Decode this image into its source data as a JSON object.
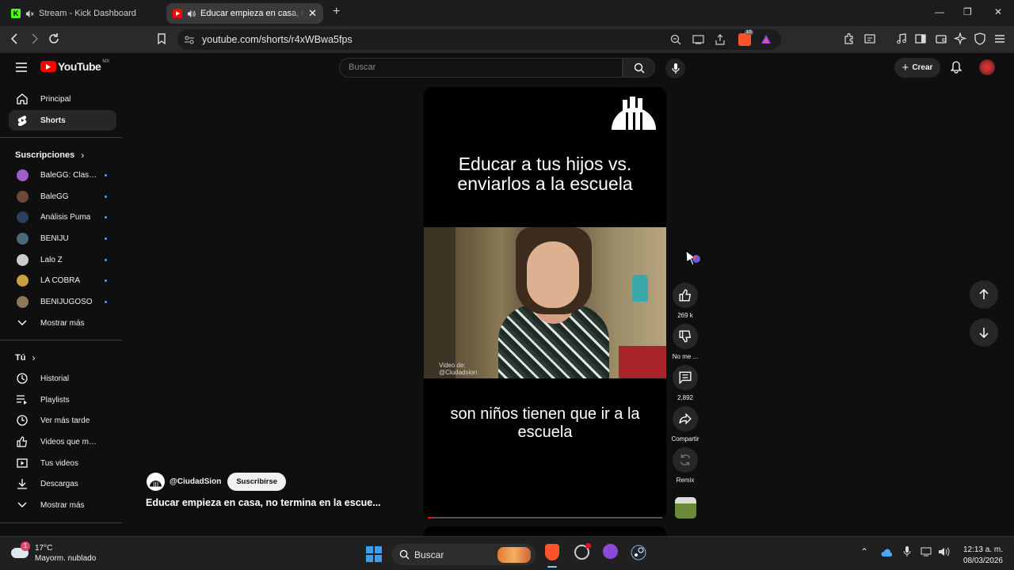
{
  "browser": {
    "tabs": [
      {
        "title": "Stream - Kick Dashboard",
        "favicon": "kick-icon"
      },
      {
        "title": "Educar empieza en casa, no te",
        "favicon": "youtube-icon"
      }
    ],
    "url": "youtube.com/shorts/r4xWBwa5fps",
    "brave_shield_count": "10"
  },
  "youtube": {
    "logo_text": "YouTube",
    "region": "MX",
    "search_placeholder": "Buscar",
    "create_label": "Crear",
    "nav": [
      {
        "label": "Principal",
        "icon": "home-icon"
      },
      {
        "label": "Shorts",
        "icon": "shorts-icon",
        "active": true
      }
    ],
    "subs_heading": "Suscripciones",
    "subscriptions": [
      {
        "label": "BaleGG: Clash R...",
        "color": "#a05cc8"
      },
      {
        "label": "BaleGG",
        "color": "#6b4a3a"
      },
      {
        "label": "Análisis Puma",
        "color": "#2d3f5c"
      },
      {
        "label": "BENIJU",
        "color": "#4a6a7a"
      },
      {
        "label": "Lalo Z",
        "color": "#cccccc"
      },
      {
        "label": "LA COBRA",
        "color": "#c8a040"
      },
      {
        "label": "BENIJUGOSO",
        "color": "#8a7a5a"
      }
    ],
    "show_more": "Mostrar más",
    "you_heading": "Tú",
    "you_items": [
      {
        "label": "Historial",
        "icon": "history-icon"
      },
      {
        "label": "Playlists",
        "icon": "playlist-icon"
      },
      {
        "label": "Ver más tarde",
        "icon": "clock-icon"
      },
      {
        "label": "Videos que me gus...",
        "icon": "like-icon"
      },
      {
        "label": "Tus videos",
        "icon": "play-square-icon"
      },
      {
        "label": "Descargas",
        "icon": "download-icon"
      }
    ],
    "show_more_2": "Mostrar más",
    "short": {
      "headline": "Educar a tus hijos vs. enviarlos a la escuela",
      "caption": "son niños tienen que ir a la escuela",
      "credit_line1": "Video de:",
      "credit_line2": "@Ciudadsion",
      "progress": 0.02
    },
    "actions": {
      "likes": "269 k",
      "dislike": "No me ...",
      "comments": "2,892",
      "share": "Compartir",
      "remix": "Remix"
    },
    "channel": {
      "handle": "@CiudadSion",
      "subscribe": "Suscribirse",
      "title": "Educar empieza en casa, no termina en la escue..."
    }
  },
  "taskbar": {
    "temperature": "17°C",
    "weather": "Mayorm. nublado",
    "weather_badge": "1",
    "search": "Buscar",
    "time": "12:13 a. m.",
    "date": "08/03/2026"
  }
}
